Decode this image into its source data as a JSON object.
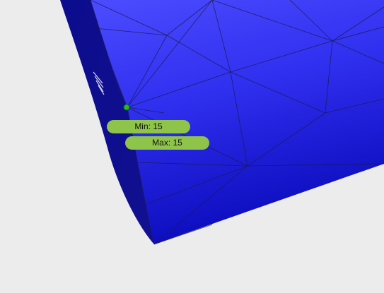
{
  "viewport": {
    "background_color": "#ececec",
    "mesh_color_top": "#4646ff",
    "mesh_color_bottom": "#0b0bb0",
    "side_color": "#0c0c8a",
    "edge_line_color": "#1a1a4a",
    "selected_vertex_color": "#22bb22"
  },
  "measure": {
    "min_label": "Min: 15",
    "max_label": "Max: 15",
    "label_color": "#8fc44a"
  }
}
